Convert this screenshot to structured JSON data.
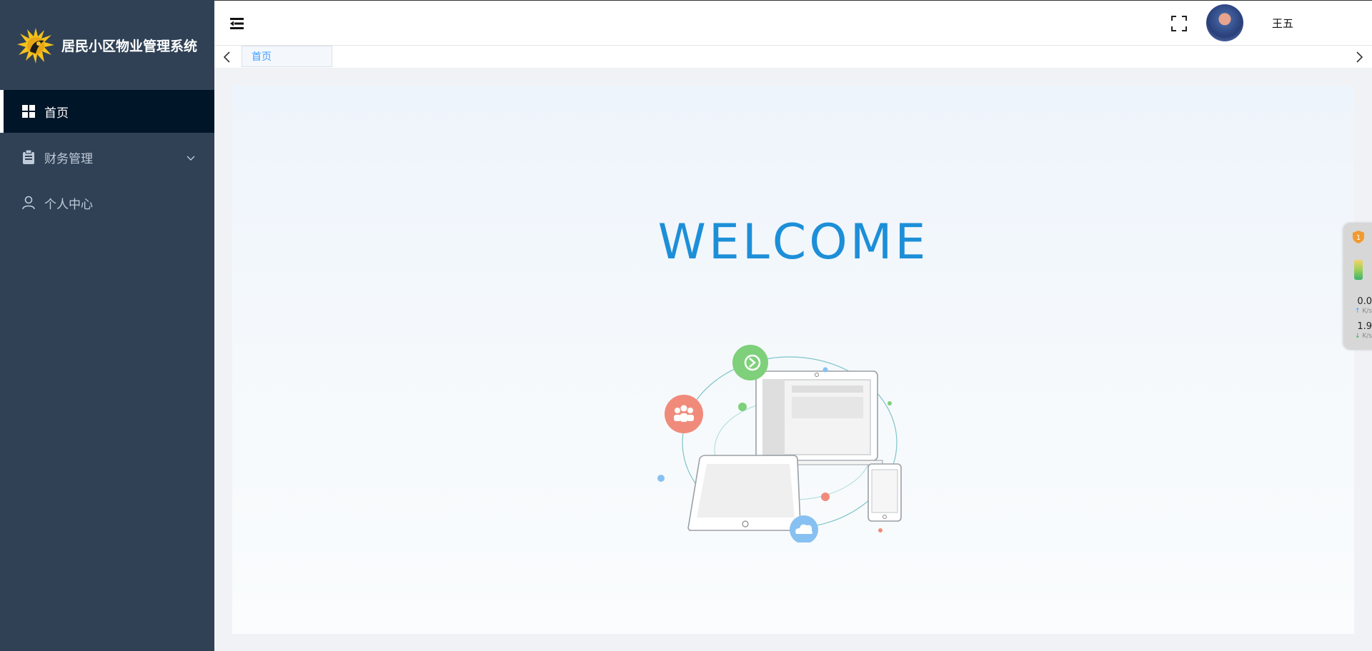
{
  "app": {
    "title": "居民小区物业管理系统"
  },
  "sidebar": {
    "items": [
      {
        "label": "首页",
        "icon": "dashboard-icon",
        "active": true
      },
      {
        "label": "财务管理",
        "icon": "clipboard-icon",
        "has_submenu": true
      },
      {
        "label": "个人中心",
        "icon": "user-icon"
      }
    ]
  },
  "navbar": {
    "username": "王五",
    "avatar_icon": "avatar",
    "fullscreen_icon": "fullscreen-icon",
    "hamburger_icon": "hamburger-icon"
  },
  "tags": {
    "items": [
      {
        "label": "首页",
        "active": true
      }
    ]
  },
  "content": {
    "welcome_text": "WELCOME"
  },
  "net_widget": {
    "upload_value": "0.0",
    "upload_unit": "K/s",
    "download_value": "1.9",
    "download_unit": "K/s",
    "badge": "1"
  },
  "colors": {
    "sidebar_bg": "#304156",
    "sidebar_active_bg": "#001528",
    "accent": "#409eff",
    "welcome": "#1d8fd8"
  }
}
